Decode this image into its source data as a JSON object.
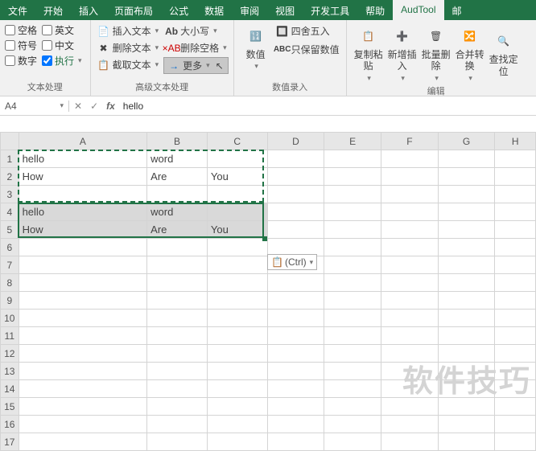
{
  "tabs": {
    "file": "文件",
    "start": "开始",
    "insert": "插入",
    "layout": "页面布局",
    "formula": "公式",
    "data": "数据",
    "review": "审阅",
    "view": "视图",
    "dev": "开发工具",
    "help": "帮助",
    "audtool": "AudTool",
    "mail": "邮"
  },
  "textproc": {
    "label": "文本处理",
    "checks": {
      "space": "空格",
      "english": "英文",
      "symbol": "符号",
      "chinese": "中文",
      "number": "数字",
      "exec": "执行"
    }
  },
  "advtext": {
    "label": "高级文本处理",
    "insert": "插入文本",
    "delete": "删除文本",
    "capture": "截取文本",
    "case": "大小写",
    "trim": "删除空格",
    "more": "更多"
  },
  "numentry": {
    "label": "数值录入",
    "num": "数值",
    "round": "四舍五入",
    "keep": "只保留数值"
  },
  "edit": {
    "label": "编辑",
    "paste": "复制粘贴",
    "addins": "新增插入",
    "batchdel": "批量删除",
    "merge": "合并转换",
    "find": "查找定位"
  },
  "cellref": "A4",
  "formula": "hello",
  "cols": [
    "A",
    "B",
    "C",
    "D",
    "E",
    "F",
    "G",
    "H"
  ],
  "rows": [
    {
      "r": 1,
      "A": "hello",
      "B": "word",
      "C": ""
    },
    {
      "r": 2,
      "A": "How",
      "B": "Are",
      "C": "You"
    },
    {
      "r": 3,
      "A": "",
      "B": "",
      "C": ""
    },
    {
      "r": 4,
      "A": "hello",
      "B": "word",
      "C": ""
    },
    {
      "r": 5,
      "A": "How",
      "B": "Are",
      "C": "You"
    }
  ],
  "blankrows": [
    6,
    7,
    8,
    9,
    10,
    11,
    12,
    13,
    14,
    15,
    16,
    17
  ],
  "ctrl": "(Ctrl)",
  "watermark": "软件技巧"
}
